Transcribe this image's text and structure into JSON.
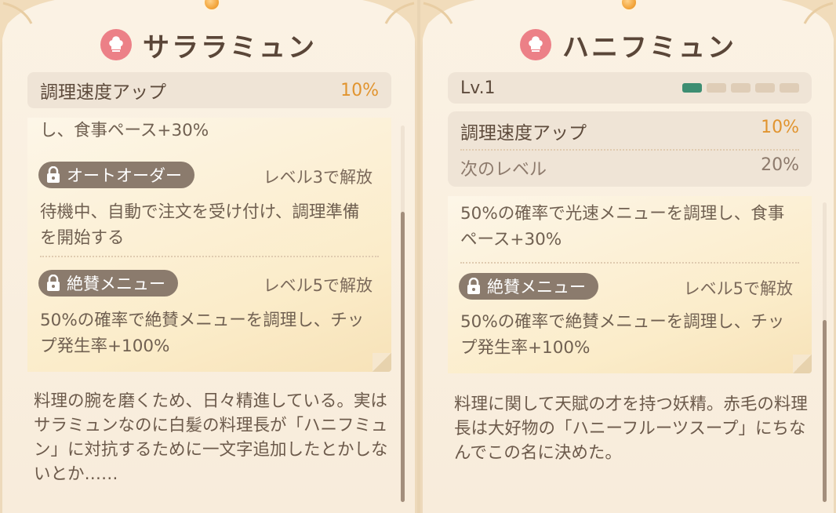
{
  "left": {
    "title": "サララミュン",
    "skill": {
      "label": "調理速度アップ",
      "value": "10%"
    },
    "scroll_top_text": "し、食事ペース+30%",
    "abilities": [
      {
        "name": "オートオーダー",
        "unlock": "レベル3で解放",
        "desc": "待機中、自動で注文を受け付け、調理準備を開始する"
      },
      {
        "name": "絶賛メニュー",
        "unlock": "レベル5で解放",
        "desc": "50%の確率で絶賛メニューを調理し、チップ発生率+100%"
      }
    ],
    "description": "料理の腕を磨くため、日々精進している。実はサラミュンなのに白髪の料理長が「ハニフミュン」に対抗するために一文字追加したとかしないとか……"
  },
  "right": {
    "title": "ハニフミュン",
    "level": {
      "label": "Lv.1",
      "current": 1,
      "max": 5
    },
    "skill": {
      "label": "調理速度アップ",
      "value": "10%"
    },
    "next": {
      "label": "次のレベル",
      "value": "20%"
    },
    "abilities": [
      {
        "name": null,
        "unlock": null,
        "desc": "50%の確率で光速メニューを調理し、食事ペース+30%"
      },
      {
        "name": "絶賛メニュー",
        "unlock": "レベル5で解放",
        "desc": "50%の確率で絶賛メニューを調理し、チップ発生率+100%"
      }
    ],
    "description": "料理に関して天賦の才を持つ妖精。赤毛の料理長は大好物の「ハニーフルーツスープ」にちなんでこの名に決めた。"
  },
  "icons": {
    "chef": "chef-hat-icon",
    "lock": "lock-icon"
  },
  "colors": {
    "accent": "#e1942f",
    "level_on": "#3d8e72",
    "pill": "#8b7b6d",
    "chef_badge": "#ec8087"
  }
}
